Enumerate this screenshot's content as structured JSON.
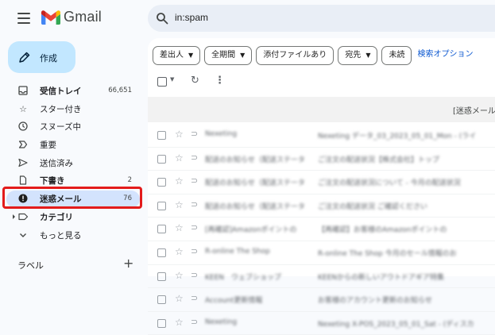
{
  "header": {
    "brand": "Gmail",
    "search_query": "in:spam"
  },
  "sidebar": {
    "compose_label": "作成",
    "items": [
      {
        "label": "受信トレイ",
        "count": "66,651",
        "icon": "inbox-icon",
        "bold": true
      },
      {
        "label": "スター付き",
        "count": "",
        "icon": "star-icon",
        "bold": false
      },
      {
        "label": "スヌーズ中",
        "count": "",
        "icon": "snooze-clock-icon",
        "bold": false
      },
      {
        "label": "重要",
        "count": "",
        "icon": "important-icon",
        "bold": false
      },
      {
        "label": "送信済み",
        "count": "",
        "icon": "send-icon",
        "bold": false
      },
      {
        "label": "下書き",
        "count": "2",
        "icon": "draft-icon",
        "bold": true
      },
      {
        "label": "迷惑メール",
        "count": "76",
        "icon": "spam-icon",
        "bold": true,
        "active": true
      },
      {
        "label": "カテゴリ",
        "count": "",
        "icon": "category-label-icon",
        "bold": true
      },
      {
        "label": "もっと見る",
        "count": "",
        "icon": "chevron-down-icon",
        "bold": false
      }
    ],
    "labels_heading": "ラベル",
    "labels_add": "+"
  },
  "filters": {
    "chips": [
      "差出人",
      "全期間",
      "添付ファイルあり",
      "宛先",
      "未読"
    ],
    "advanced_link": "検索オプション"
  },
  "banner_text": "[迷惑メール",
  "emails": [
    {
      "sender": "Nexeting",
      "subject": "Nexeting データ_03_2023_05_01_Mon - (ライ"
    },
    {
      "sender": "配送のお知らせ（配送ステータ",
      "subject": "ご注文の配送状況【株式会社】トップ"
    },
    {
      "sender": "配送のお知らせ（配送ステータ",
      "subject": "ご注文の配送状況について - 今月の配送状況"
    },
    {
      "sender": "配送のお知らせ（配送ステータ",
      "subject": "ご注文の配送状況 ご確認ください"
    },
    {
      "sender": "[再確認]Amazonポイントの",
      "subject": "【再確認】お客様のAmazonポイントの"
    },
    {
      "sender": "R-online The Shop",
      "subject": "R-online The Shop 今月のセール情報のお"
    },
    {
      "sender": "KEEN　ウェブショップ",
      "subject": "KEENからの新しいアウトドアギア特集"
    },
    {
      "sender": "Account更新情報",
      "subject": "お客様のアカウント更新のお知らせ"
    },
    {
      "sender": "Nexeting",
      "subject": "Nexeting X-POS_2023_05_01_Sat - (ディスカ"
    }
  ],
  "colors": {
    "accent": "#0b57d0",
    "active_pill": "#d3e3fd",
    "compose": "#c2e7ff",
    "highlight_box": "#e31b1b",
    "search_bg": "#e9eef6"
  }
}
